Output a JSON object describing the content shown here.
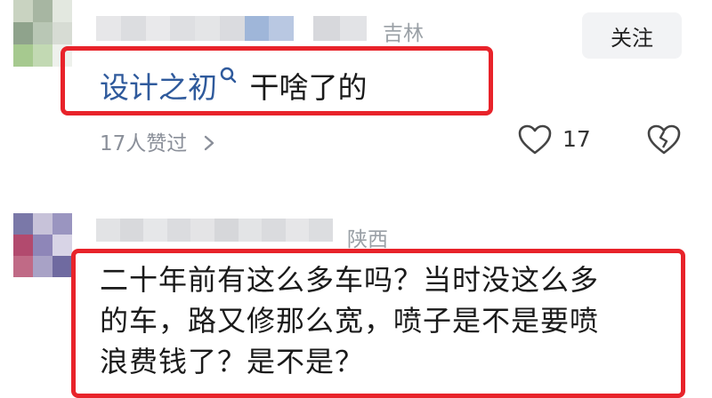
{
  "comments": [
    {
      "region": "吉林",
      "follow_label": "关注",
      "text_link": "设计之初",
      "text_rest": "干啥了的",
      "likes_summary": "17人赞过",
      "like_count": "17"
    },
    {
      "region": "陕西",
      "text_lines": [
        "二十年前有这么多车吗？当时没这么多",
        "的车，路又修那么宽，喷子是不是要喷",
        "浪费钱了？是不是？"
      ]
    }
  ],
  "colors": {
    "highlight_border": "#e8232a",
    "link": "#2f5a9c",
    "meta_text": "#8a8f99"
  },
  "icons": [
    "search-icon",
    "chevron-right-icon",
    "heart-icon",
    "broken-heart-icon"
  ]
}
